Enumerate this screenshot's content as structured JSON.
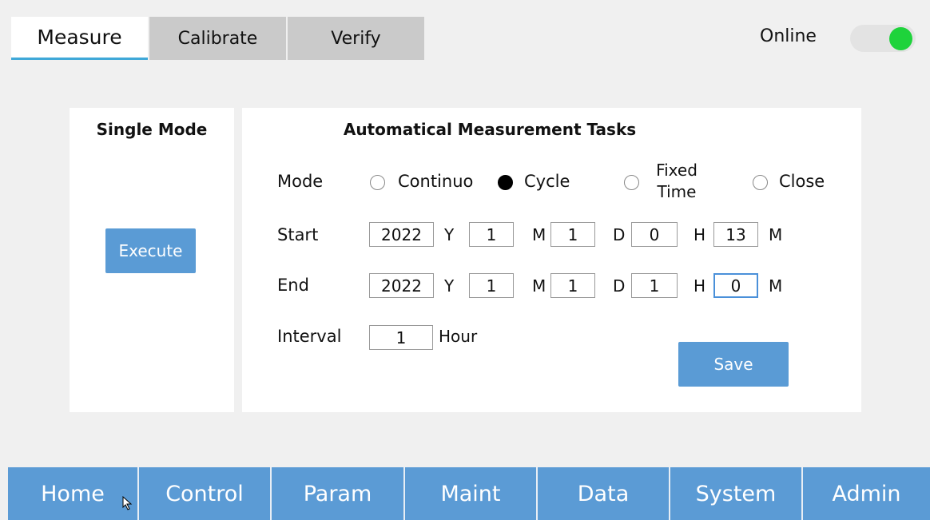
{
  "tabs": [
    "Measure",
    "Calibrate",
    "Verify"
  ],
  "status": {
    "label": "Online",
    "on": true,
    "color": "#1ed33b"
  },
  "single_mode": {
    "title": "Single Mode",
    "execute_label": "Execute"
  },
  "auto": {
    "title": "Automatical Measurement Tasks",
    "mode_label": "Mode",
    "modes": {
      "continuo": "Continuo",
      "cycle": "Cycle",
      "fixed_line1": "Fixed",
      "fixed_line2": "Time",
      "close": "Close"
    },
    "selected_mode": "Cycle",
    "start": {
      "label": "Start",
      "year": "2022",
      "month": "1",
      "day": "1",
      "hour": "0",
      "minute": "13"
    },
    "end": {
      "label": "End",
      "year": "2022",
      "month": "1",
      "day": "1",
      "hour": "1",
      "minute": "0"
    },
    "units": {
      "y": "Y",
      "m": "M",
      "d": "D",
      "h": "H",
      "min": "M"
    },
    "interval": {
      "label": "Interval",
      "value": "1",
      "unit": "Hour"
    },
    "save_label": "Save"
  },
  "nav": [
    "Home",
    "Control",
    "Param",
    "Maint",
    "Data",
    "System",
    "Admin"
  ],
  "colors": {
    "accent": "#5b9bd5",
    "tab_underline": "#3fa8d8"
  }
}
